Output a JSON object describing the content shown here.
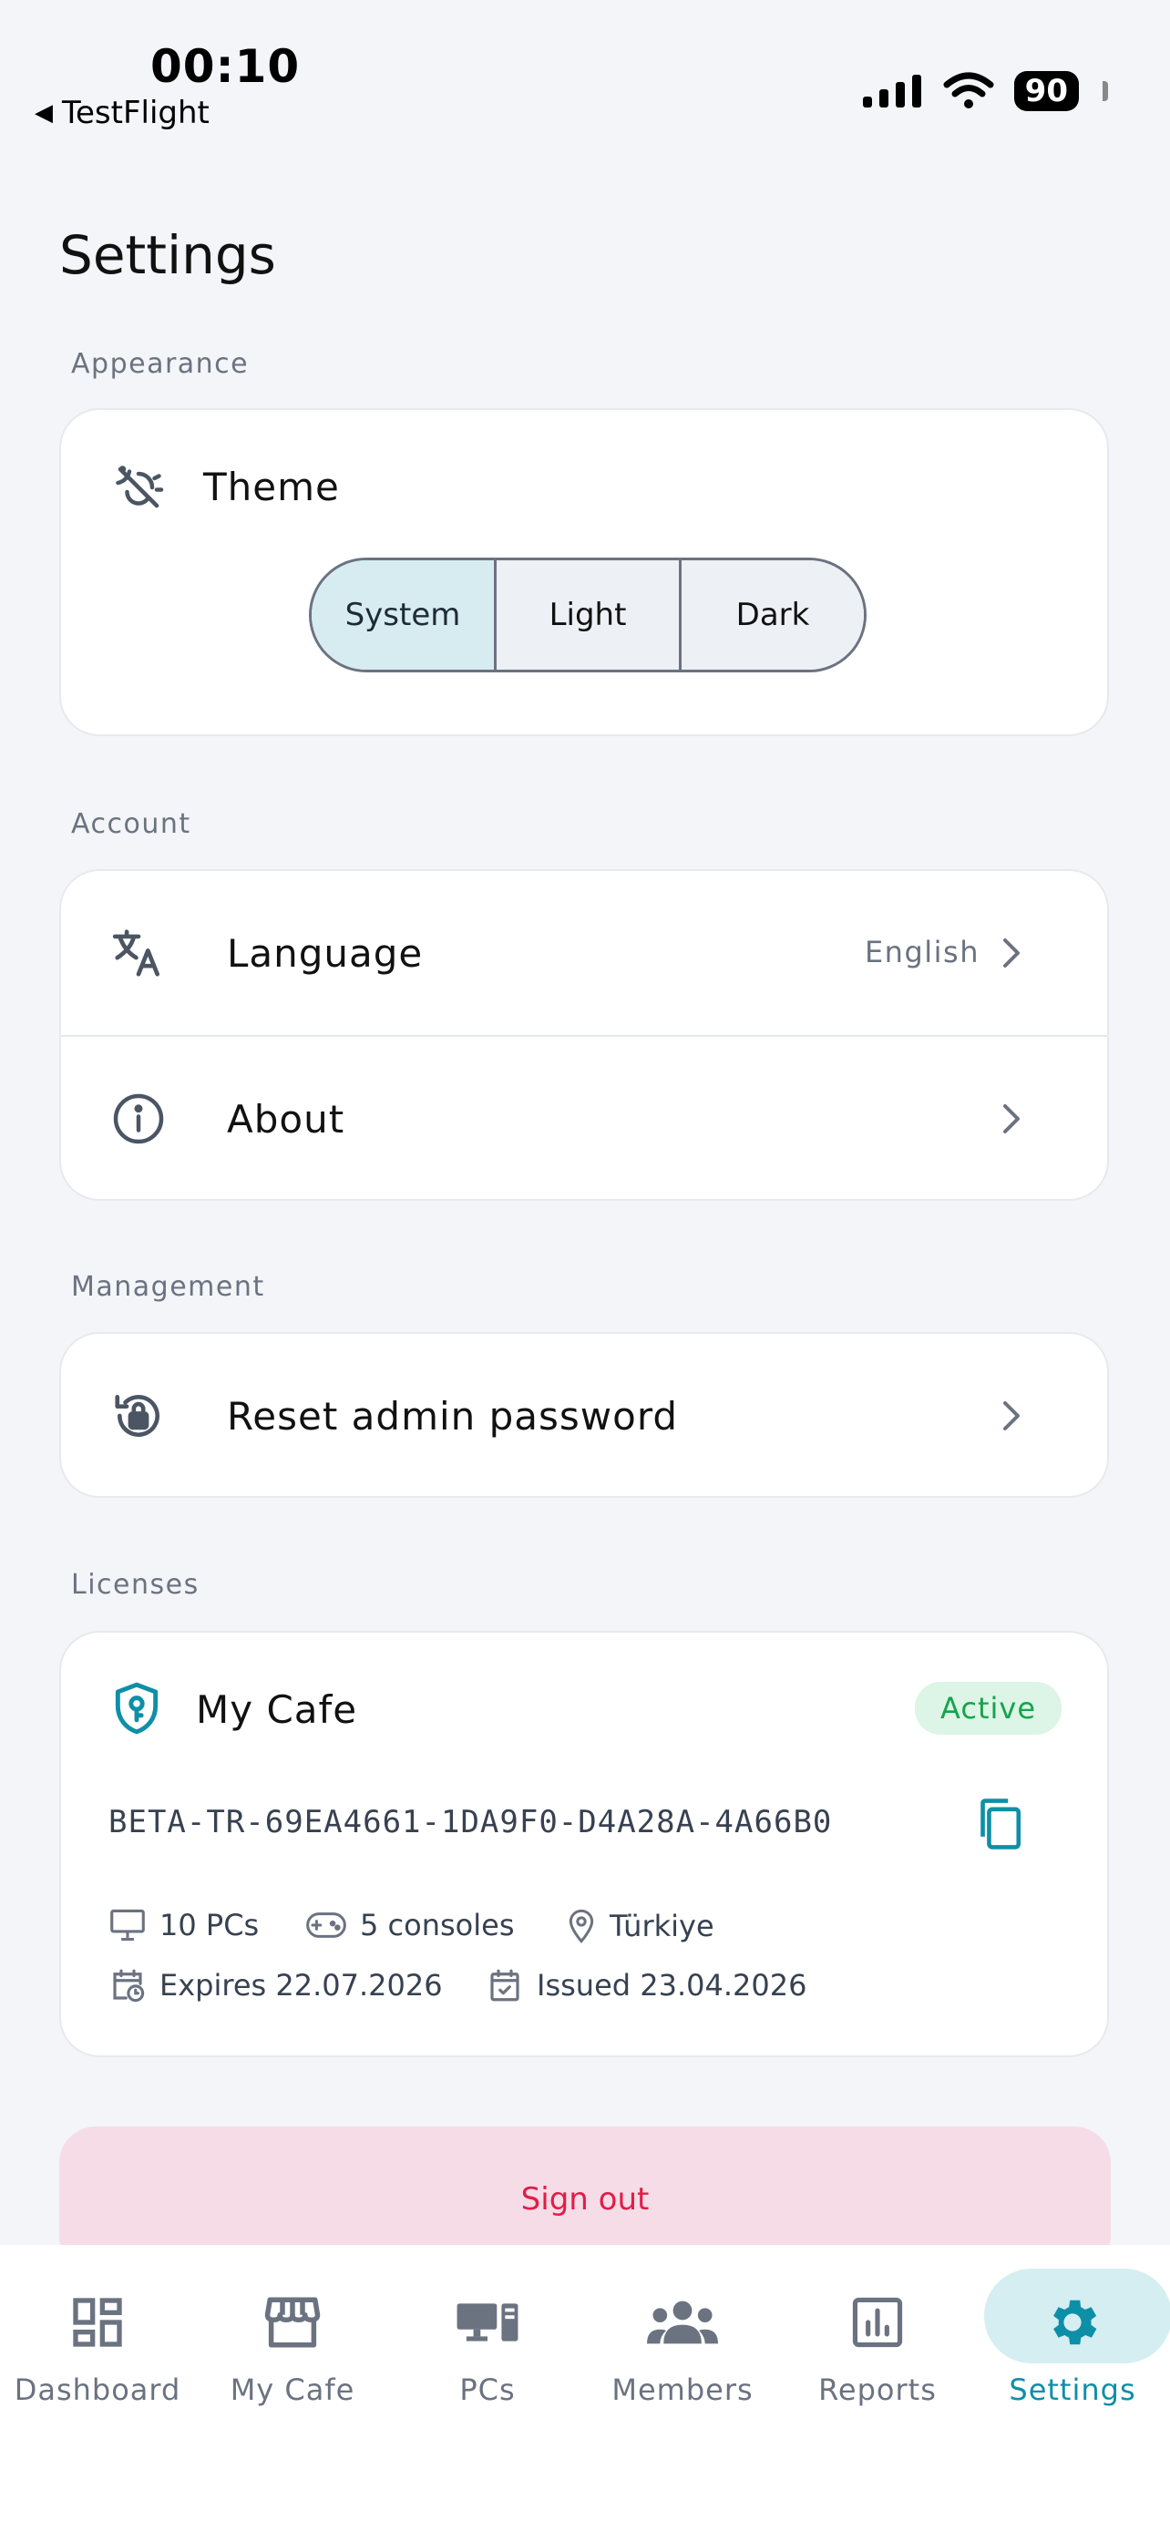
{
  "status_bar": {
    "time": "00:10",
    "back_app": "TestFlight",
    "battery": "90"
  },
  "page_title": "Settings",
  "sections": {
    "appearance": "Appearance",
    "account": "Account",
    "management": "Management",
    "licenses": "Licenses"
  },
  "theme": {
    "label": "Theme",
    "options": [
      "System",
      "Light",
      "Dark"
    ],
    "selected": "System"
  },
  "account": {
    "language": {
      "label": "Language",
      "value": "English"
    },
    "about": {
      "label": "About"
    }
  },
  "management": {
    "reset": {
      "label": "Reset admin password"
    }
  },
  "license": {
    "name": "My Cafe",
    "status": "Active",
    "key": "BETA-TR-69EA4661-1DA9F0-D4A28A-4A66B0",
    "pcs": "10 PCs",
    "consoles": "5 consoles",
    "country": "Türkiye",
    "expires": "Expires 22.07.2026",
    "issued": "Issued 23.04.2026"
  },
  "signout": "Sign out",
  "tabs": [
    {
      "label": "Dashboard"
    },
    {
      "label": "My Cafe"
    },
    {
      "label": "PCs"
    },
    {
      "label": "Members"
    },
    {
      "label": "Reports"
    },
    {
      "label": "Settings"
    }
  ],
  "active_tab": "Settings",
  "colors": {
    "accent": "#0e8fa8",
    "active_green": "#16a34a",
    "danger": "#e11d48"
  }
}
